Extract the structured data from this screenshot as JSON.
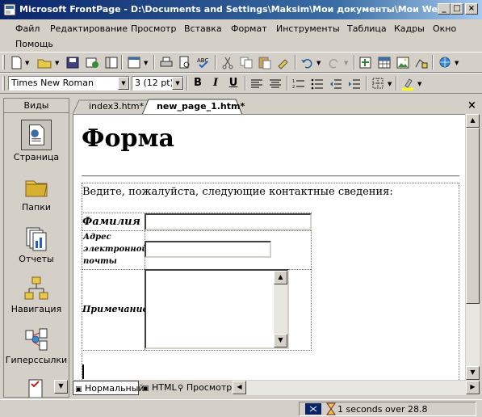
{
  "window": {
    "title": "Microsoft FrontPage - D:\\Documents and Settings\\Maksim\\Мои документы\\Мои Web\\n..."
  },
  "menu": [
    "Файл",
    "Редактирование",
    "Просмотр",
    "Вставка",
    "Формат",
    "Инструменты",
    "Таблица",
    "Кадры",
    "Окно",
    "Помощь"
  ],
  "format_toolbar": {
    "font_name": "Times New Roman",
    "font_size": "3  (12 pt)",
    "bold": "B",
    "italic": "I",
    "underline": "U"
  },
  "views": {
    "header": "Виды",
    "items": [
      "Страница",
      "Папки",
      "Отчеты",
      "Навигация",
      "Гиперссылки"
    ]
  },
  "tabs": {
    "items": [
      "index3.htm*",
      "new_page_1.htm*"
    ],
    "active": "new_page_1.htm*"
  },
  "page": {
    "heading": "Форма",
    "intro": "Ведите, пожалуйста, следующие контактные сведения:",
    "field_surname": "Фамилия",
    "field_email_1": "Адрес",
    "field_email_2": "электронной",
    "field_email_3": "почты",
    "field_note": "Примечание"
  },
  "view_modes": {
    "normal": "Нормальный",
    "html": "HTML",
    "preview": "Просмотр"
  },
  "status": {
    "text": "1 seconds over 28.8"
  }
}
